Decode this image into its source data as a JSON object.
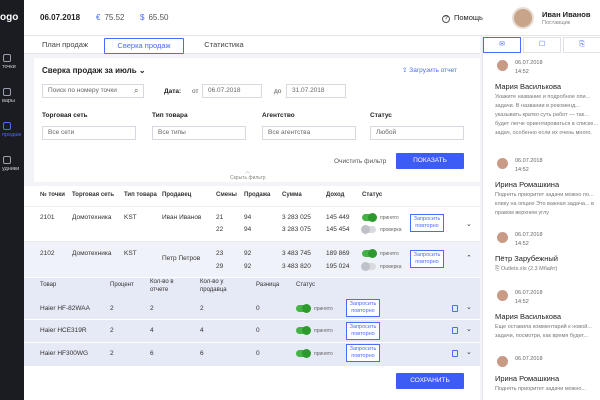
{
  "sidebar": {
    "logo": "ogo",
    "items": [
      {
        "label": "точки",
        "icon": "location-icon"
      },
      {
        "label": "вары",
        "icon": "box-icon"
      },
      {
        "label": "продаж",
        "icon": "chart-icon",
        "active": true
      },
      {
        "label": "удники",
        "icon": "people-icon"
      }
    ]
  },
  "header": {
    "date": "06.07.2018",
    "currency1_symbol": "€",
    "currency1_value": "75.52",
    "currency2_symbol": "$",
    "currency2_value": "65.50",
    "help_label": "Помощь",
    "user_name": "Иван Иванов",
    "user_role": "Поставщик"
  },
  "tabs": [
    "План продаж",
    "Сверка продаж",
    "Статистика"
  ],
  "filters": {
    "title": "Сверка продаж за июль",
    "load_report": "Загрузить отчет",
    "search_placeholder": "Поиск по номеру точки",
    "date_label": "Дата:",
    "from_label": "от",
    "from_value": "06.07.2018",
    "to_label": "до",
    "to_value": "31.07.2018",
    "network_label": "Торговая сеть",
    "network_value": "Все сети",
    "type_label": "Тип товара",
    "type_value": "Все типы",
    "agency_label": "Агентство",
    "agency_value": "Все агентства",
    "status_label": "Статус",
    "status_value": "Любой",
    "clear_label": "Очистить фильтр",
    "show_label": "ПОКАЗАТЬ",
    "hide_label": "Скрыть фильтр"
  },
  "table": {
    "headers": [
      "№ точки",
      "Торговая сеть",
      "Тип товара",
      "Продавец",
      "Смены",
      "Продажа",
      "Сумма",
      "Доход",
      "Статус"
    ],
    "rows": [
      {
        "point": "2101",
        "network": "Домотехника",
        "type": "KST",
        "seller": "Иван Иванов",
        "shifts": [
          "21",
          "22"
        ],
        "sales": [
          "94",
          "94"
        ],
        "sums": [
          "3 283 025",
          "3 283 075"
        ],
        "income": [
          "145 449",
          "145 454"
        ],
        "statuses": [
          "принято",
          "проверка"
        ],
        "toggles": [
          true,
          false
        ]
      },
      {
        "point": "2102",
        "network": "Домотехника",
        "type": "KST",
        "seller": "Петр Петров",
        "shifts": [
          "23",
          "29"
        ],
        "sales": [
          "92",
          "92"
        ],
        "sums": [
          "3 483 745",
          "3 483 820"
        ],
        "income": [
          "189 869",
          "195 024"
        ],
        "statuses": [
          "принято",
          "проверка"
        ],
        "toggles": [
          true,
          false
        ]
      }
    ],
    "request_label": "Запросить повторно",
    "sub_headers": [
      "Товар",
      "Процент",
      "Кол-во в отчете",
      "Кол-во у продавца",
      "Разница",
      "Статус"
    ],
    "sub_rows": [
      {
        "product": "Haier HF-82WAA",
        "percent": "2",
        "report": "2",
        "seller": "2",
        "diff": "0",
        "status": "принято"
      },
      {
        "product": "Haier HCE319R",
        "percent": "2",
        "report": "4",
        "seller": "4",
        "diff": "0",
        "status": "принято"
      },
      {
        "product": "Haier HF300WG",
        "percent": "2",
        "report": "6",
        "seller": "6",
        "diff": "0",
        "status": "принято"
      }
    ],
    "save_label": "СОХРАНИТЬ"
  },
  "chat": {
    "messages": [
      {
        "date": "06.07.2018",
        "time": "14:52",
        "name": "Мария Василькова",
        "text": "Укажите название и подробное опи... задачи. В названии в рекоменд... указывать кратко суть работ — так... будет легче ориентироваться в списке... задач, особенно если их очень много."
      },
      {
        "date": "06.07.2018",
        "time": "14:52",
        "name": "Ирина Ромашкина",
        "text": "Поднять приоритет задачи можно по... клику на опцию Это важная задача... в правом верхнем углу"
      },
      {
        "date": "06.07.2018",
        "time": "14:52",
        "name": "Пётр Зарубежный",
        "text": "Outlets.xls (2.3 Мбайт)"
      },
      {
        "date": "06.07.2018",
        "time": "14:52",
        "name": "Мария Василькова",
        "text": "Еще оставила комментарий к новой... задачи, посмотри, как время будет..."
      },
      {
        "date": "06.07.2018",
        "time": "",
        "name": "Ирина Ромашкина",
        "text": "Поднять приоритет задачи можно..."
      }
    ]
  }
}
